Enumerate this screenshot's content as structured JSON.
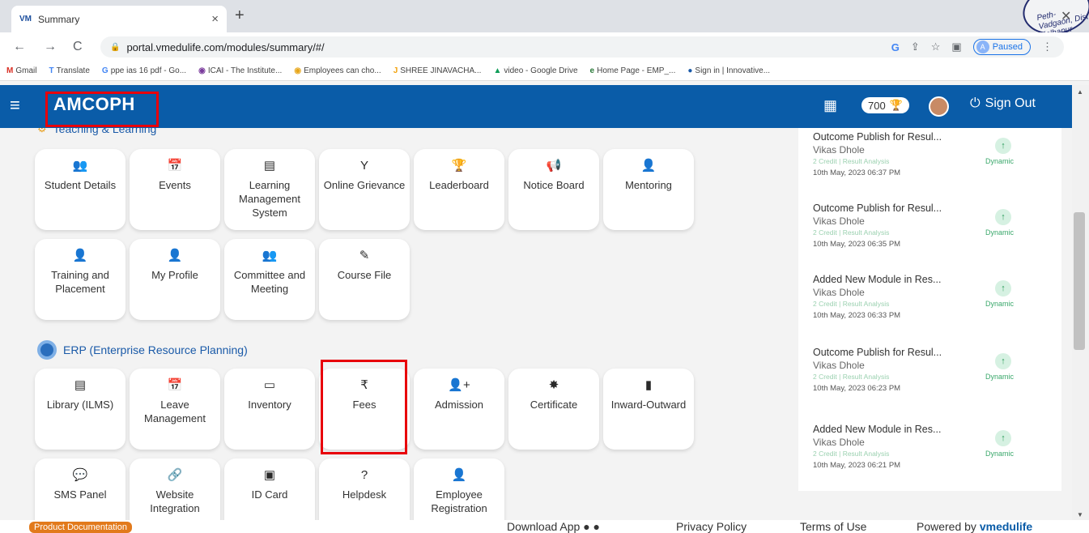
{
  "browser": {
    "tab_title": "Summary",
    "tab_favicon": "VM",
    "url": "portal.vmedulife.com/modules/summary/#/",
    "profile_initial": "A",
    "profile_status": "Paused",
    "bookmarks": [
      {
        "icon": "M",
        "label": "Gmail"
      },
      {
        "icon": "T",
        "label": "Translate"
      },
      {
        "icon": "G",
        "label": "ppe ias 16 pdf - Go..."
      },
      {
        "icon": "◉",
        "label": "ICAI - The Institute..."
      },
      {
        "icon": "◉",
        "label": "Employees can cho..."
      },
      {
        "icon": "J",
        "label": "SHREE JINAVACHA..."
      },
      {
        "icon": "▲",
        "label": "video - Google Drive"
      },
      {
        "icon": "e",
        "label": "Home Page - EMP_..."
      },
      {
        "icon": "●",
        "label": "Sign in | Innovative..."
      }
    ]
  },
  "stamp_text": "Peth-Vadgaon, Dist. Kolhapur",
  "header": {
    "brand": "AMCOPH",
    "points": "700",
    "signout_label": "Sign Out"
  },
  "sections": {
    "teaching": {
      "title": "Teaching & Learning"
    },
    "erp": {
      "title": "ERP (Enterprise Resource Planning)"
    }
  },
  "tiles": {
    "t1": {
      "icon": "👥",
      "label": "Student Details"
    },
    "t2": {
      "icon": "📅",
      "label": "Events"
    },
    "t3": {
      "icon": "▤",
      "label": "Learning Management System"
    },
    "t4": {
      "icon": "Y",
      "label": "Online Grievance"
    },
    "t5": {
      "icon": "🏆",
      "label": "Leaderboard"
    },
    "t6": {
      "icon": "📢",
      "label": "Notice Board"
    },
    "t7": {
      "icon": "👤",
      "label": "Mentoring"
    },
    "t8": {
      "icon": "👤",
      "label": "Training and Placement"
    },
    "t9": {
      "icon": "👤",
      "label": "My Profile"
    },
    "t10": {
      "icon": "👥",
      "label": "Committee and Meeting"
    },
    "t11": {
      "icon": "✎",
      "label": "Course File"
    },
    "e1": {
      "icon": "▤",
      "label": "Library (ILMS)"
    },
    "e2": {
      "icon": "📅",
      "label": "Leave Management"
    },
    "e3": {
      "icon": "▭",
      "label": "Inventory"
    },
    "e4": {
      "icon": "₹",
      "label": "Fees"
    },
    "e5": {
      "icon": "👤+",
      "label": "Admission"
    },
    "e6": {
      "icon": "✸",
      "label": "Certificate"
    },
    "e7": {
      "icon": "▮",
      "label": "Inward-Outward"
    },
    "e8": {
      "icon": "💬",
      "label": "SMS Panel"
    },
    "e9": {
      "icon": "🔗",
      "label": "Website Integration"
    },
    "e10": {
      "icon": "▣",
      "label": "ID Card"
    },
    "e11": {
      "icon": "?",
      "label": "Helpdesk"
    },
    "e12": {
      "icon": "👤",
      "label": "Employee Registration"
    }
  },
  "activity": [
    {
      "title": "Outcome Publish for Resul...",
      "user": "Vikas Dhole",
      "sub": "2 Credit | Result Analysis",
      "date": "10th May, 2023 06:37 PM",
      "tag": "Dynamic"
    },
    {
      "title": "Outcome Publish for Resul...",
      "user": "Vikas Dhole",
      "sub": "2 Credit | Result Analysis",
      "date": "10th May, 2023 06:35 PM",
      "tag": "Dynamic"
    },
    {
      "title": "Added New Module in Res...",
      "user": "Vikas Dhole",
      "sub": "2 Credit | Result Analysis",
      "date": "10th May, 2023 06:33 PM",
      "tag": "Dynamic"
    },
    {
      "title": "Outcome Publish for Resul...",
      "user": "Vikas Dhole",
      "sub": "2 Credit | Result Analysis",
      "date": "10th May, 2023 06:23 PM",
      "tag": "Dynamic"
    },
    {
      "title": "Added New Module in Res...",
      "user": "Vikas Dhole",
      "sub": "2 Credit | Result Analysis",
      "date": "10th May, 2023 06:21 PM",
      "tag": "Dynamic"
    }
  ],
  "footer": {
    "product_doc": "Product Documentation",
    "download_app": "Download App",
    "privacy": "Privacy Policy",
    "terms": "Terms of Use",
    "powered_prefix": "Powered by",
    "powered_brand": "vmedulife"
  },
  "colors": {
    "header_bg": "#0a5ca8",
    "highlight": "#e8000a",
    "accent_green": "#3aa86b"
  }
}
